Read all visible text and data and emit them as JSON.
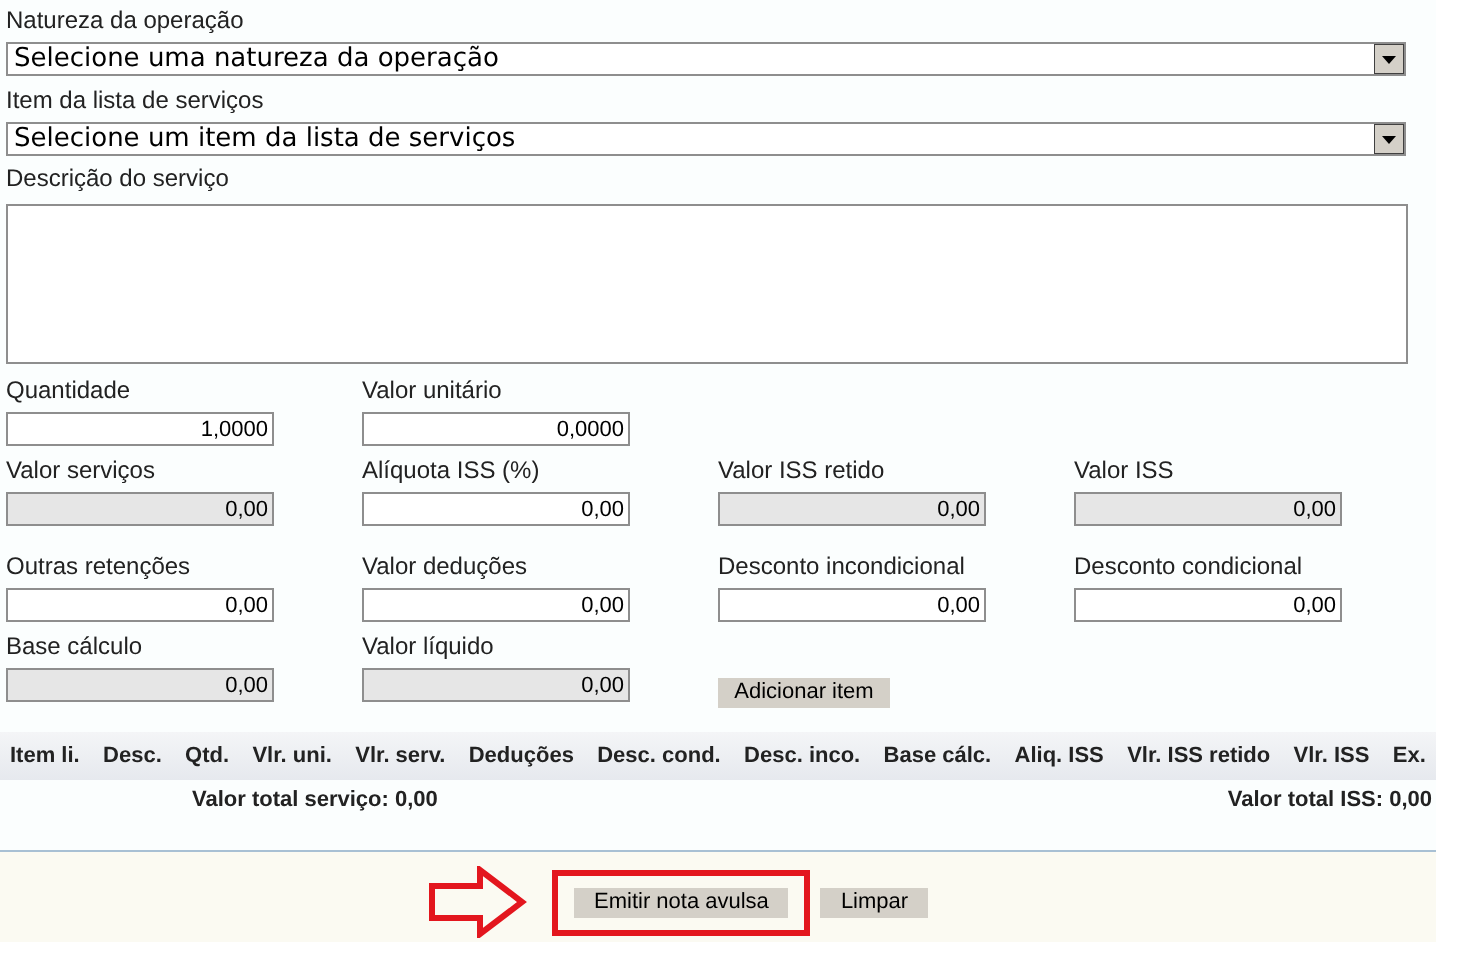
{
  "selects": [
    {
      "label": "Natureza da operação",
      "value": "Selecione uma natureza da operação"
    },
    {
      "label": "Item da lista de serviços",
      "value": "Selecione um item da lista de serviços"
    }
  ],
  "description": {
    "label": "Descrição do serviço"
  },
  "field_rows": [
    [
      {
        "kind": "field",
        "label": "Quantidade",
        "value": "1,0000",
        "readonly": false
      },
      {
        "kind": "field",
        "label": "Valor unitário",
        "value": "0,0000",
        "readonly": false
      }
    ],
    [
      {
        "kind": "field",
        "label": "Valor serviços",
        "value": "0,00",
        "readonly": true
      },
      {
        "kind": "field",
        "label": "Alíquota ISS (%)",
        "value": "0,00",
        "readonly": false
      },
      {
        "kind": "field",
        "label": "Valor ISS retido",
        "value": "0,00",
        "readonly": true
      },
      {
        "kind": "field",
        "label": "Valor ISS",
        "value": "0,00",
        "readonly": true
      }
    ],
    [
      {
        "kind": "field",
        "label": "Outras retenções",
        "value": "0,00",
        "readonly": false
      },
      {
        "kind": "field",
        "label": "Valor deduções",
        "value": "0,00",
        "readonly": false
      },
      {
        "kind": "field",
        "label": "Desconto incondicional",
        "value": "0,00",
        "readonly": false
      },
      {
        "kind": "field",
        "label": "Desconto condicional",
        "value": "0,00",
        "readonly": false
      }
    ],
    [
      {
        "kind": "field",
        "label": "Base cálculo",
        "value": "0,00",
        "readonly": true
      },
      {
        "kind": "field",
        "label": "Valor líquido",
        "value": "0,00",
        "readonly": true
      },
      {
        "kind": "button",
        "label": "Adicionar item"
      }
    ]
  ],
  "table": {
    "columns": [
      "Item li.",
      "Desc.",
      "Qtd.",
      "Vlr. uni.",
      "Vlr. serv.",
      "Deduções",
      "Desc. cond.",
      "Desc. inco.",
      "Base cálc.",
      "Aliq. ISS",
      "Vlr. ISS retido",
      "Vlr. ISS",
      "Ex."
    ]
  },
  "totals": {
    "service": "Valor total serviço: 0,00",
    "iss": "Valor total ISS: 0,00"
  },
  "actions": [
    {
      "label": "Emitir nota avulsa",
      "highlighted": true
    },
    {
      "label": "Limpar",
      "highlighted": false
    }
  ]
}
